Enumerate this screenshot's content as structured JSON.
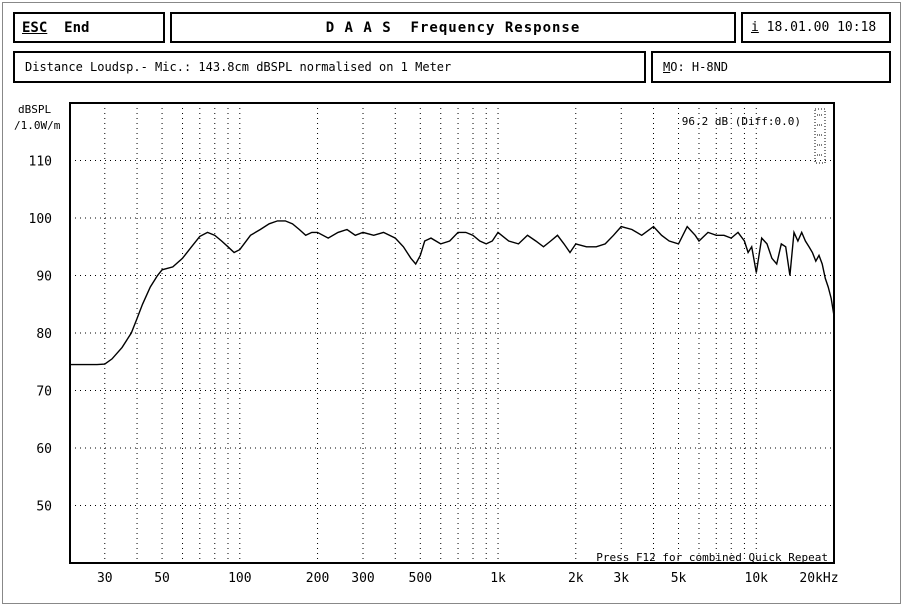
{
  "header": {
    "esc_key": "ESC",
    "esc_label": "End",
    "title": "D A A S  Frequency Response",
    "info_key": "i",
    "datetime": "18.01.00 10:18"
  },
  "info": {
    "distance_text": "Distance Loudsp.- Mic.: 143.8cm dBSPL normalised on 1 Meter",
    "model_key": "M",
    "model_text": "O: H-8ND"
  },
  "readout": "96.2 dB (Diff:0.0)",
  "footer_hint": "Press F12 for combined Quick Repeat",
  "chart_data": {
    "type": "line",
    "title": "D A A S  Frequency Response",
    "ylabel_line1": "dBSPL",
    "ylabel_line2": "/1.0W/m",
    "xscale": "log",
    "xlim": [
      22,
      20000
    ],
    "ylim": [
      40,
      120
    ],
    "grid": true,
    "yticks": [
      50,
      60,
      70,
      80,
      90,
      100,
      110
    ],
    "xticks": [
      {
        "v": 30,
        "label": "30"
      },
      {
        "v": 50,
        "label": "50"
      },
      {
        "v": 100,
        "label": "100"
      },
      {
        "v": 200,
        "label": "200"
      },
      {
        "v": 300,
        "label": "300"
      },
      {
        "v": 500,
        "label": "500"
      },
      {
        "v": 1000,
        "label": "1k"
      },
      {
        "v": 2000,
        "label": "2k"
      },
      {
        "v": 3000,
        "label": "3k"
      },
      {
        "v": 5000,
        "label": "5k"
      },
      {
        "v": 10000,
        "label": "10k"
      },
      {
        "v": 20000,
        "label": "20kHz"
      }
    ],
    "series": [
      {
        "x": [
          22,
          25,
          28,
          30,
          32,
          35,
          38,
          40,
          42,
          45,
          48,
          50,
          55,
          60,
          65,
          70,
          75,
          80,
          85,
          90,
          95,
          100,
          110,
          120,
          130,
          140,
          150,
          160,
          170,
          180,
          190,
          200,
          220,
          240,
          260,
          280,
          300,
          330,
          360,
          400,
          430,
          460,
          480,
          500,
          520,
          550,
          600,
          650,
          700,
          750,
          800,
          850,
          900,
          950,
          1000,
          1100,
          1200,
          1300,
          1400,
          1500,
          1600,
          1700,
          1800,
          1900,
          2000,
          2200,
          2400,
          2600,
          2800,
          3000,
          3300,
          3600,
          4000,
          4300,
          4600,
          5000,
          5400,
          5800,
          6000,
          6500,
          7000,
          7500,
          8000,
          8500,
          9000,
          9300,
          9600,
          10000,
          10500,
          11000,
          11500,
          12000,
          12500,
          13000,
          13500,
          14000,
          14500,
          15000,
          15500,
          16000,
          16500,
          17000,
          17500,
          18000,
          18500,
          19000,
          19500,
          20000
        ],
        "y": [
          74.5,
          74.5,
          74.5,
          74.6,
          75.5,
          77.5,
          80.0,
          82.5,
          85.0,
          88.0,
          90.0,
          91.0,
          91.5,
          93.0,
          95.0,
          96.8,
          97.5,
          97.0,
          96.0,
          95.0,
          94.0,
          94.5,
          97.0,
          98.0,
          99.0,
          99.5,
          99.5,
          99.0,
          98.0,
          97.0,
          97.5,
          97.5,
          96.5,
          97.5,
          98.0,
          97.0,
          97.5,
          97.0,
          97.5,
          96.5,
          95.0,
          93.0,
          92.0,
          93.5,
          96.0,
          96.5,
          95.5,
          96.0,
          97.5,
          97.5,
          97.0,
          96.0,
          95.5,
          96.0,
          97.5,
          96.0,
          95.5,
          97.0,
          96.0,
          95.0,
          96.0,
          97.0,
          95.5,
          94.0,
          95.5,
          95.0,
          95.0,
          95.5,
          97.0,
          98.5,
          98.0,
          97.0,
          98.5,
          97.0,
          96.0,
          95.5,
          98.5,
          97.0,
          96.0,
          97.5,
          97.0,
          97.0,
          96.5,
          97.5,
          96.0,
          94.0,
          95.0,
          90.5,
          96.5,
          95.5,
          93.0,
          92.0,
          95.5,
          95.0,
          90.0,
          97.5,
          96.0,
          97.5,
          96.0,
          95.0,
          94.0,
          92.5,
          93.5,
          92.0,
          89.5,
          88.0,
          86.0,
          83.0
        ]
      }
    ]
  }
}
